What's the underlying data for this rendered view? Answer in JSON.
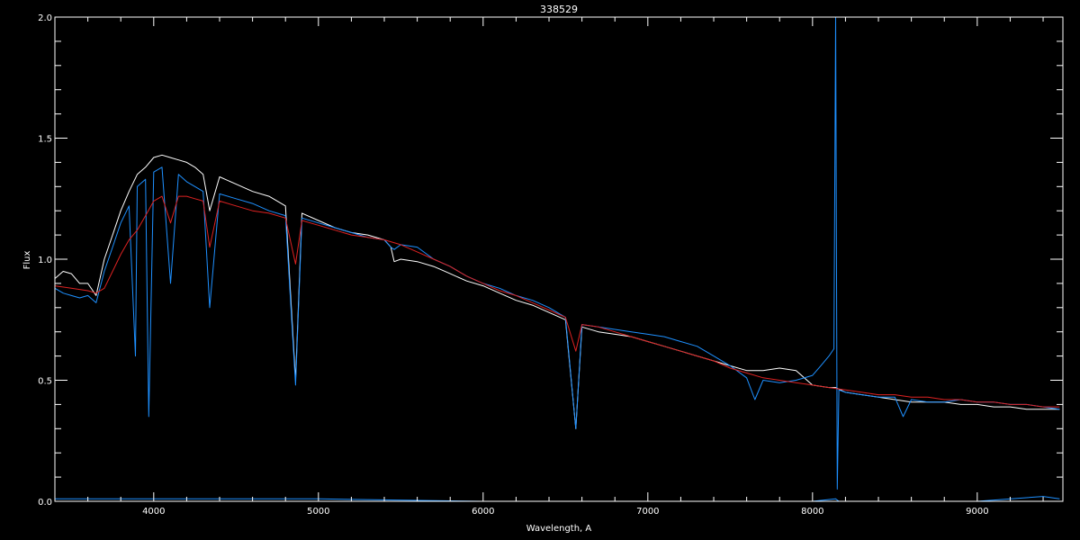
{
  "chart_data": {
    "type": "line",
    "title": "338529",
    "xlabel": "Wavelength, A",
    "ylabel": "Flux",
    "xlim": [
      3400,
      9520
    ],
    "ylim": [
      0.0,
      2.0
    ],
    "x_ticks": [
      4000,
      5000,
      6000,
      7000,
      8000,
      9000
    ],
    "x_tick_labels": [
      "4000",
      "5000",
      "6000",
      "7000",
      "8000",
      "9000"
    ],
    "y_ticks": [
      0.0,
      0.5,
      1.0,
      1.5,
      2.0
    ],
    "y_tick_labels": [
      "0.0",
      "0.5",
      "1.0",
      "1.5",
      "2.0"
    ],
    "grid": false,
    "background": "#000000",
    "axis_color": "#ffffff",
    "series": [
      {
        "color": "#ffffff",
        "x": [
          3400,
          3450,
          3500,
          3550,
          3600,
          3650,
          3700,
          3750,
          3800,
          3850,
          3900,
          3950,
          4000,
          4050,
          4100,
          4150,
          4200,
          4250,
          4300,
          4340,
          4400,
          4500,
          4600,
          4700,
          4800,
          4861,
          4900,
          5000,
          5100,
          5200,
          5300,
          5400,
          5440,
          5460,
          5500,
          5600,
          5700,
          5800,
          5900,
          6000,
          6100,
          6200,
          6300,
          6400,
          6500,
          6563,
          6600,
          6700,
          6800,
          6900,
          7000,
          7100,
          7200,
          7300,
          7400,
          7500,
          7600,
          7700,
          7800,
          7900,
          8000,
          8100,
          8140,
          8200,
          8300,
          8400,
          8500,
          8600,
          8700,
          8800,
          8900,
          9000,
          9100,
          9200,
          9300,
          9400,
          9500
        ],
        "y": [
          0.92,
          0.95,
          0.94,
          0.9,
          0.9,
          0.85,
          1.0,
          1.1,
          1.2,
          1.28,
          1.35,
          1.38,
          1.42,
          1.43,
          1.42,
          1.41,
          1.4,
          1.38,
          1.35,
          1.2,
          1.34,
          1.31,
          1.28,
          1.26,
          1.22,
          0.5,
          1.19,
          1.16,
          1.13,
          1.11,
          1.1,
          1.08,
          1.05,
          0.99,
          1.0,
          0.99,
          0.97,
          0.94,
          0.91,
          0.89,
          0.86,
          0.83,
          0.81,
          0.78,
          0.75,
          0.3,
          0.72,
          0.7,
          0.69,
          0.68,
          0.66,
          0.64,
          0.62,
          0.6,
          0.58,
          0.56,
          0.54,
          0.54,
          0.55,
          0.54,
          0.48,
          0.47,
          0.47,
          0.45,
          0.44,
          0.43,
          0.42,
          0.41,
          0.41,
          0.41,
          0.4,
          0.4,
          0.39,
          0.39,
          0.38,
          0.38,
          0.38
        ]
      },
      {
        "color": "#1e90ff",
        "x": [
          3400,
          3450,
          3500,
          3550,
          3600,
          3650,
          3700,
          3750,
          3800,
          3850,
          3889,
          3900,
          3950,
          3970,
          4000,
          4050,
          4102,
          4150,
          4200,
          4250,
          4300,
          4340,
          4400,
          4500,
          4600,
          4700,
          4800,
          4861,
          4900,
          5000,
          5100,
          5200,
          5300,
          5400,
          5440,
          5460,
          5500,
          5600,
          5700,
          5800,
          5900,
          6000,
          6100,
          6200,
          6300,
          6400,
          6500,
          6563,
          6600,
          6700,
          6800,
          6900,
          7000,
          7100,
          7200,
          7300,
          7400,
          7500,
          7600,
          7650,
          7700,
          7800,
          7900,
          8000,
          8050,
          8100,
          8130,
          8140,
          8150,
          8160,
          8200,
          8300,
          8400,
          8500,
          8550,
          8600,
          8700,
          8800,
          8900,
          9000,
          9100,
          9200,
          9300,
          9400,
          9500
        ],
        "y": [
          0.88,
          0.86,
          0.85,
          0.84,
          0.85,
          0.82,
          0.95,
          1.05,
          1.15,
          1.22,
          0.6,
          1.3,
          1.33,
          0.35,
          1.36,
          1.38,
          0.9,
          1.35,
          1.32,
          1.3,
          1.28,
          0.8,
          1.27,
          1.25,
          1.23,
          1.2,
          1.18,
          0.48,
          1.17,
          1.15,
          1.13,
          1.11,
          1.09,
          1.08,
          1.05,
          1.04,
          1.06,
          1.05,
          1.0,
          0.97,
          0.93,
          0.9,
          0.88,
          0.85,
          0.83,
          0.8,
          0.76,
          0.3,
          0.73,
          0.72,
          0.71,
          0.7,
          0.69,
          0.68,
          0.66,
          0.64,
          0.6,
          0.56,
          0.51,
          0.42,
          0.5,
          0.49,
          0.5,
          0.52,
          0.56,
          0.6,
          0.63,
          2.0,
          0.05,
          0.46,
          0.45,
          0.44,
          0.43,
          0.43,
          0.35,
          0.42,
          0.41,
          0.41,
          0.42,
          0.41,
          0.41,
          0.4,
          0.4,
          0.39,
          0.38
        ]
      },
      {
        "color": "#dd2222",
        "x": [
          3400,
          3500,
          3600,
          3650,
          3700,
          3750,
          3800,
          3850,
          3900,
          3950,
          4000,
          4050,
          4102,
          4150,
          4200,
          4250,
          4300,
          4340,
          4400,
          4500,
          4600,
          4700,
          4800,
          4861,
          4900,
          5000,
          5100,
          5200,
          5300,
          5400,
          5500,
          5600,
          5700,
          5800,
          5900,
          6000,
          6100,
          6200,
          6300,
          6400,
          6500,
          6563,
          6600,
          6700,
          6800,
          6900,
          7000,
          7100,
          7200,
          7300,
          7400,
          7500,
          7600,
          7700,
          7800,
          7900,
          8000,
          8100,
          8200,
          8300,
          8400,
          8500,
          8600,
          8700,
          8800,
          8900,
          9000,
          9100,
          9200,
          9300,
          9400,
          9500
        ],
        "y": [
          0.89,
          0.88,
          0.87,
          0.86,
          0.88,
          0.95,
          1.02,
          1.08,
          1.12,
          1.18,
          1.24,
          1.26,
          1.15,
          1.26,
          1.26,
          1.25,
          1.24,
          1.05,
          1.24,
          1.22,
          1.2,
          1.19,
          1.17,
          0.98,
          1.16,
          1.14,
          1.12,
          1.1,
          1.09,
          1.08,
          1.06,
          1.03,
          1.0,
          0.97,
          0.93,
          0.9,
          0.87,
          0.85,
          0.82,
          0.79,
          0.76,
          0.62,
          0.73,
          0.72,
          0.7,
          0.68,
          0.66,
          0.64,
          0.62,
          0.6,
          0.58,
          0.55,
          0.53,
          0.51,
          0.5,
          0.49,
          0.48,
          0.47,
          0.46,
          0.45,
          0.44,
          0.44,
          0.43,
          0.43,
          0.42,
          0.42,
          0.41,
          0.41,
          0.4,
          0.4,
          0.39,
          0.39
        ]
      },
      {
        "color": "#1e90ff",
        "x": [
          3400,
          4000,
          5000,
          6000,
          7000,
          8000,
          8140,
          8160,
          9000,
          9400,
          9500
        ],
        "y": [
          0.01,
          0.01,
          0.01,
          0.0,
          0.0,
          0.0,
          0.01,
          0.0,
          0.0,
          0.02,
          0.01
        ]
      }
    ]
  }
}
